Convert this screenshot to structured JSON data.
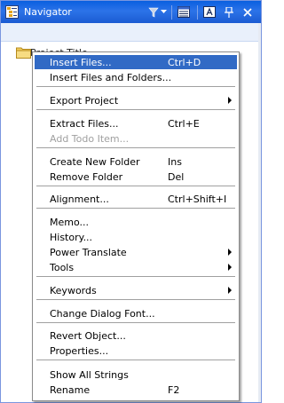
{
  "window": {
    "title": "Navigator"
  },
  "tree": {
    "item_label": "Project Title"
  },
  "menu": {
    "items": [
      {
        "label": "Insert Files...",
        "shortcut": "Ctrl+D",
        "submenu": false,
        "disabled": false,
        "highlighted": true
      },
      {
        "label": "Insert Files and Folders...",
        "shortcut": "",
        "submenu": false,
        "disabled": false,
        "highlighted": false
      },
      {
        "label": "Export Project",
        "shortcut": "",
        "submenu": true,
        "disabled": false,
        "highlighted": false
      },
      {
        "label": "Extract Files...",
        "shortcut": "Ctrl+E",
        "submenu": false,
        "disabled": false,
        "highlighted": false
      },
      {
        "label": "Add Todo Item...",
        "shortcut": "",
        "submenu": false,
        "disabled": true,
        "highlighted": false
      },
      {
        "label": "Create New Folder",
        "shortcut": "Ins",
        "submenu": false,
        "disabled": false,
        "highlighted": false
      },
      {
        "label": "Remove Folder",
        "shortcut": "Del",
        "submenu": false,
        "disabled": false,
        "highlighted": false
      },
      {
        "label": "Alignment...",
        "shortcut": "Ctrl+Shift+I",
        "submenu": false,
        "disabled": false,
        "highlighted": false
      },
      {
        "label": "Memo...",
        "shortcut": "",
        "submenu": false,
        "disabled": false,
        "highlighted": false
      },
      {
        "label": "History...",
        "shortcut": "",
        "submenu": false,
        "disabled": false,
        "highlighted": false
      },
      {
        "label": "Power Translate",
        "shortcut": "",
        "submenu": true,
        "disabled": false,
        "highlighted": false
      },
      {
        "label": "Tools",
        "shortcut": "",
        "submenu": true,
        "disabled": false,
        "highlighted": false
      },
      {
        "label": "Keywords",
        "shortcut": "",
        "submenu": true,
        "disabled": false,
        "highlighted": false
      },
      {
        "label": "Change Dialog Font...",
        "shortcut": "",
        "submenu": false,
        "disabled": false,
        "highlighted": false
      },
      {
        "label": "Revert Object...",
        "shortcut": "",
        "submenu": false,
        "disabled": false,
        "highlighted": false
      },
      {
        "label": "Properties...",
        "shortcut": "",
        "submenu": false,
        "disabled": false,
        "highlighted": false
      },
      {
        "label": "Show All Strings",
        "shortcut": "",
        "submenu": false,
        "disabled": false,
        "highlighted": false
      },
      {
        "label": "Rename",
        "shortcut": "F2",
        "submenu": false,
        "disabled": false,
        "highlighted": false
      }
    ]
  },
  "colors": {
    "titlebar": "#0a5fe0",
    "highlight": "#316ac5",
    "disabled_text": "#a0a0a0"
  },
  "icons": [
    "navigator-app-icon",
    "filter-icon",
    "dropdown-arrow-icon",
    "grid-view-icon",
    "font-icon",
    "pin-icon",
    "close-icon",
    "folder-icon",
    "submenu-arrow-icon"
  ]
}
